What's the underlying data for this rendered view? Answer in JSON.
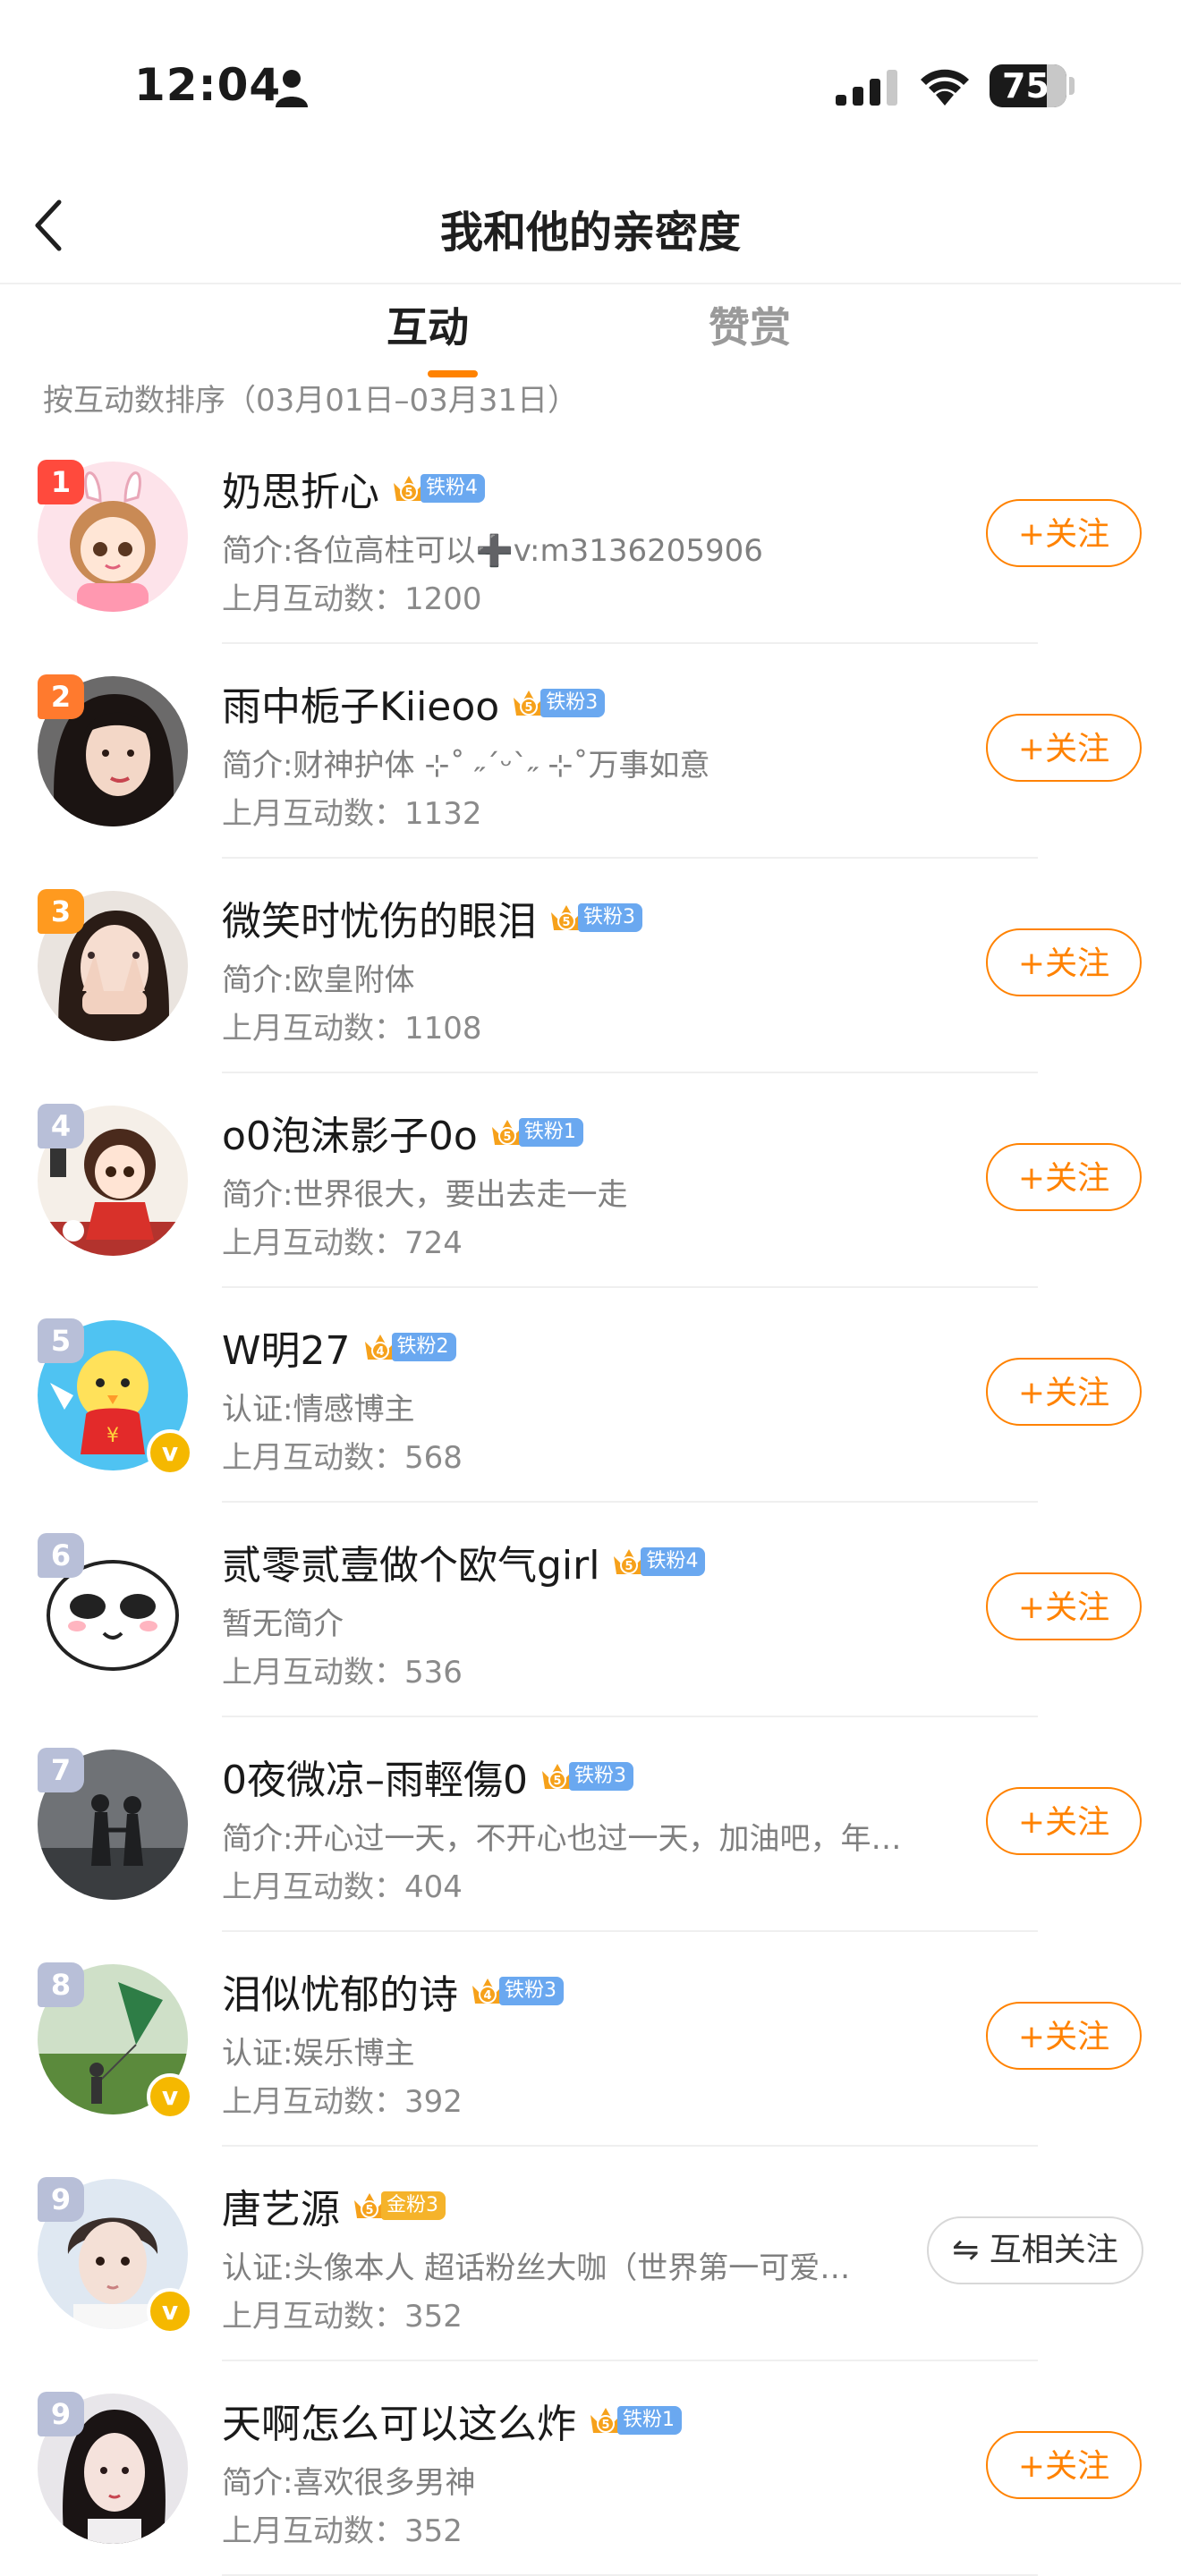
{
  "status_bar": {
    "time": "12:04",
    "battery": "75"
  },
  "nav": {
    "title": "我和他的亲密度"
  },
  "tabs": [
    {
      "label": "互动",
      "active": true
    },
    {
      "label": "赞赏",
      "active": false
    }
  ],
  "sort_caption": "按互动数排序（03月01日–03月31日）",
  "count_prefix": "上月互动数：",
  "colors": {
    "accent": "#ff8200",
    "rank_top": "#ff4a3d",
    "rank_second": "#ff7a2e",
    "rank_third": "#ff9a1f",
    "rank_rest": "#b8bfd8",
    "iron_badge": "#6aa8f0",
    "gold_badge": "#f5b32a"
  },
  "fans": [
    {
      "rank": "1",
      "name": "奶思折心",
      "badge_level": "5",
      "badge_label": "铁粉4",
      "badge_type": "iron",
      "bio": "简介:各位高柱可以➕v:m3136205906",
      "count": "1200",
      "action": "+关注",
      "verified": false
    },
    {
      "rank": "2",
      "name": "雨中栀子Kiieoo",
      "badge_level": "5",
      "badge_label": "铁粉3",
      "badge_type": "iron",
      "bio": "简介:财神护体 ⊹˚ ˶ˊᵕˋ˶ ⊹˚万事如意",
      "count": "1132",
      "action": "+关注",
      "verified": false
    },
    {
      "rank": "3",
      "name": "微笑时忧伤的眼泪",
      "badge_level": "5",
      "badge_label": "铁粉3",
      "badge_type": "iron",
      "bio": "简介:欧皇附体",
      "count": "1108",
      "action": "+关注",
      "verified": false
    },
    {
      "rank": "4",
      "name": "o0泡沫影子0o",
      "badge_level": "5",
      "badge_label": "铁粉1",
      "badge_type": "iron",
      "bio": "简介:世界很大，要出去走一走",
      "count": "724",
      "action": "+关注",
      "verified": false
    },
    {
      "rank": "5",
      "name": "W明27",
      "badge_level": "4",
      "badge_label": "铁粉2",
      "badge_type": "iron",
      "bio": "认证:情感博主",
      "count": "568",
      "action": "+关注",
      "verified": true
    },
    {
      "rank": "6",
      "name": "贰零贰壹做个欧气girl",
      "badge_level": "5",
      "badge_label": "铁粉4",
      "badge_type": "iron",
      "bio": "暂无简介",
      "count": "536",
      "action": "+关注",
      "verified": false
    },
    {
      "rank": "7",
      "name": "0夜微凉–雨輕傷0",
      "badge_level": "5",
      "badge_label": "铁粉3",
      "badge_type": "iron",
      "bio": "简介:开心过一天，不开心也过一天，加油吧，年…",
      "count": "404",
      "action": "+关注",
      "verified": false
    },
    {
      "rank": "8",
      "name": "泪似忧郁的诗",
      "badge_level": "4",
      "badge_label": "铁粉3",
      "badge_type": "iron",
      "bio": "认证:娱乐博主",
      "count": "392",
      "action": "+关注",
      "verified": true
    },
    {
      "rank": "9",
      "name": "唐艺源",
      "badge_level": "5",
      "badge_label": "金粉3",
      "badge_type": "gold",
      "bio": "认证:头像本人 超话粉丝大咖（世界第一可爱…",
      "count": "352",
      "action": "⇋ 互相关注",
      "verified": true
    },
    {
      "rank": "9",
      "name": "天啊怎么可以这么炸",
      "badge_level": "5",
      "badge_label": "铁粉1",
      "badge_type": "iron",
      "bio": "简介:喜欢很多男神",
      "count": "352",
      "action": "+关注",
      "verified": false
    }
  ]
}
